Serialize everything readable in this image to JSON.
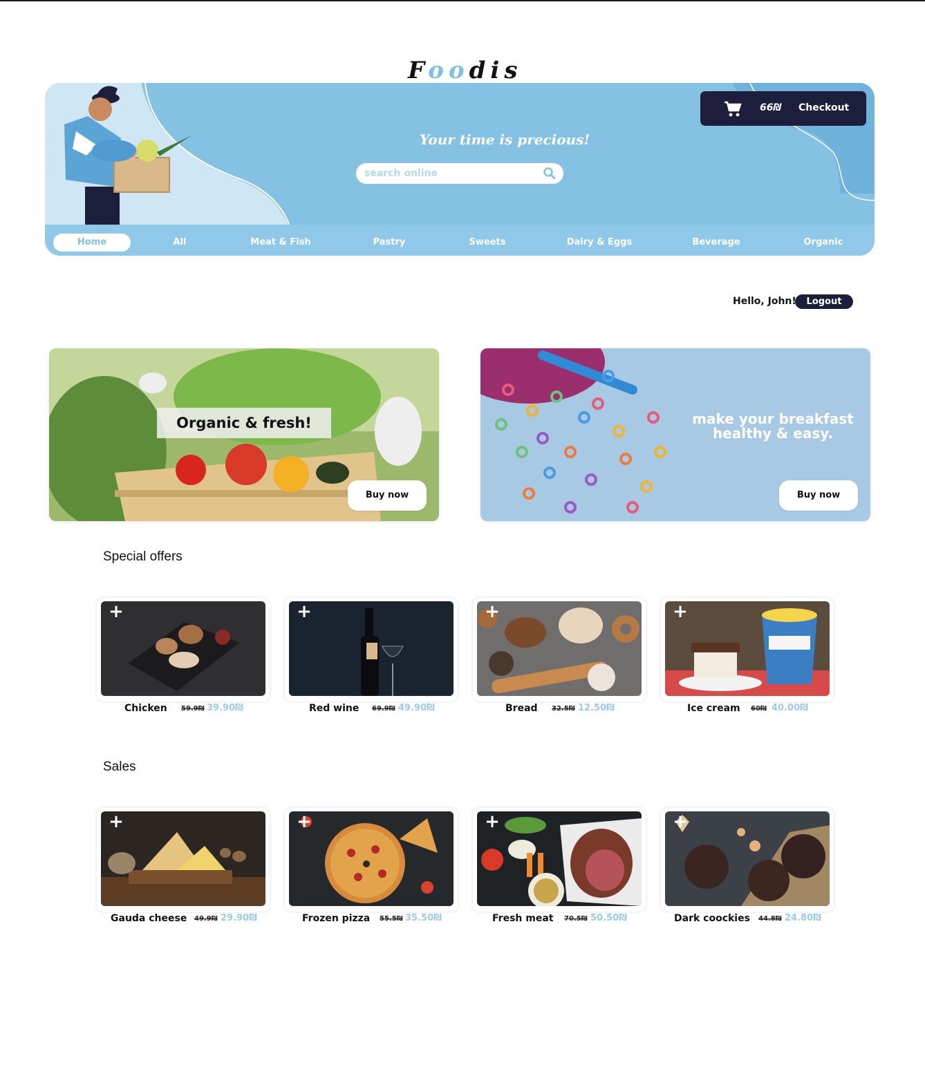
{
  "logo": {
    "text_start": "F",
    "text_o1": "o",
    "text_o2": "o",
    "text_end": "dis"
  },
  "header": {
    "tagline": "Your time is precious!",
    "search_placeholder": "search online",
    "cart_total": "66₪",
    "checkout_label": "Checkout"
  },
  "nav": {
    "items": [
      {
        "label": "Home",
        "active": true
      },
      {
        "label": "All"
      },
      {
        "label": "Meat & Fish"
      },
      {
        "label": "Pastry"
      },
      {
        "label": "Sweets"
      },
      {
        "label": "Dairy & Eggs"
      },
      {
        "label": "Beverage"
      },
      {
        "label": "Organic"
      }
    ]
  },
  "user": {
    "greeting": "Hello, John!",
    "logout_label": "Logout"
  },
  "promos": [
    {
      "label": "Organic & fresh!",
      "button": "Buy now"
    },
    {
      "line1": "make your breakfast",
      "line2": "healthy & easy.",
      "button": "Buy now"
    }
  ],
  "special_offers": {
    "title": "Special offers",
    "items": [
      {
        "name": "Chicken",
        "old_price": "59.9₪",
        "new_price": "39.90₪"
      },
      {
        "name": "Red wine",
        "old_price": "69.9₪",
        "new_price": "49.90₪"
      },
      {
        "name": "Bread",
        "old_price": "32.5₪",
        "new_price": "12.50₪"
      },
      {
        "name": "Ice cream",
        "old_price": "60₪",
        "new_price": "40.00₪"
      }
    ]
  },
  "sales": {
    "title": "Sales",
    "items": [
      {
        "name": "Gauda cheese",
        "old_price": "49.9₪",
        "new_price": "29.90₪"
      },
      {
        "name": "Frozen pizza",
        "old_price": "55.5₪",
        "new_price": "35.50₪"
      },
      {
        "name": "Fresh meat",
        "old_price": "70.5₪",
        "new_price": "50.50₪"
      },
      {
        "name": "Dark coockies",
        "old_price": "44.8₪",
        "new_price": "24.80₪"
      }
    ]
  },
  "colors": {
    "brand_blue": "#84c1e3",
    "navy": "#1c1e3c",
    "price_blue": "#9ccbe8"
  }
}
